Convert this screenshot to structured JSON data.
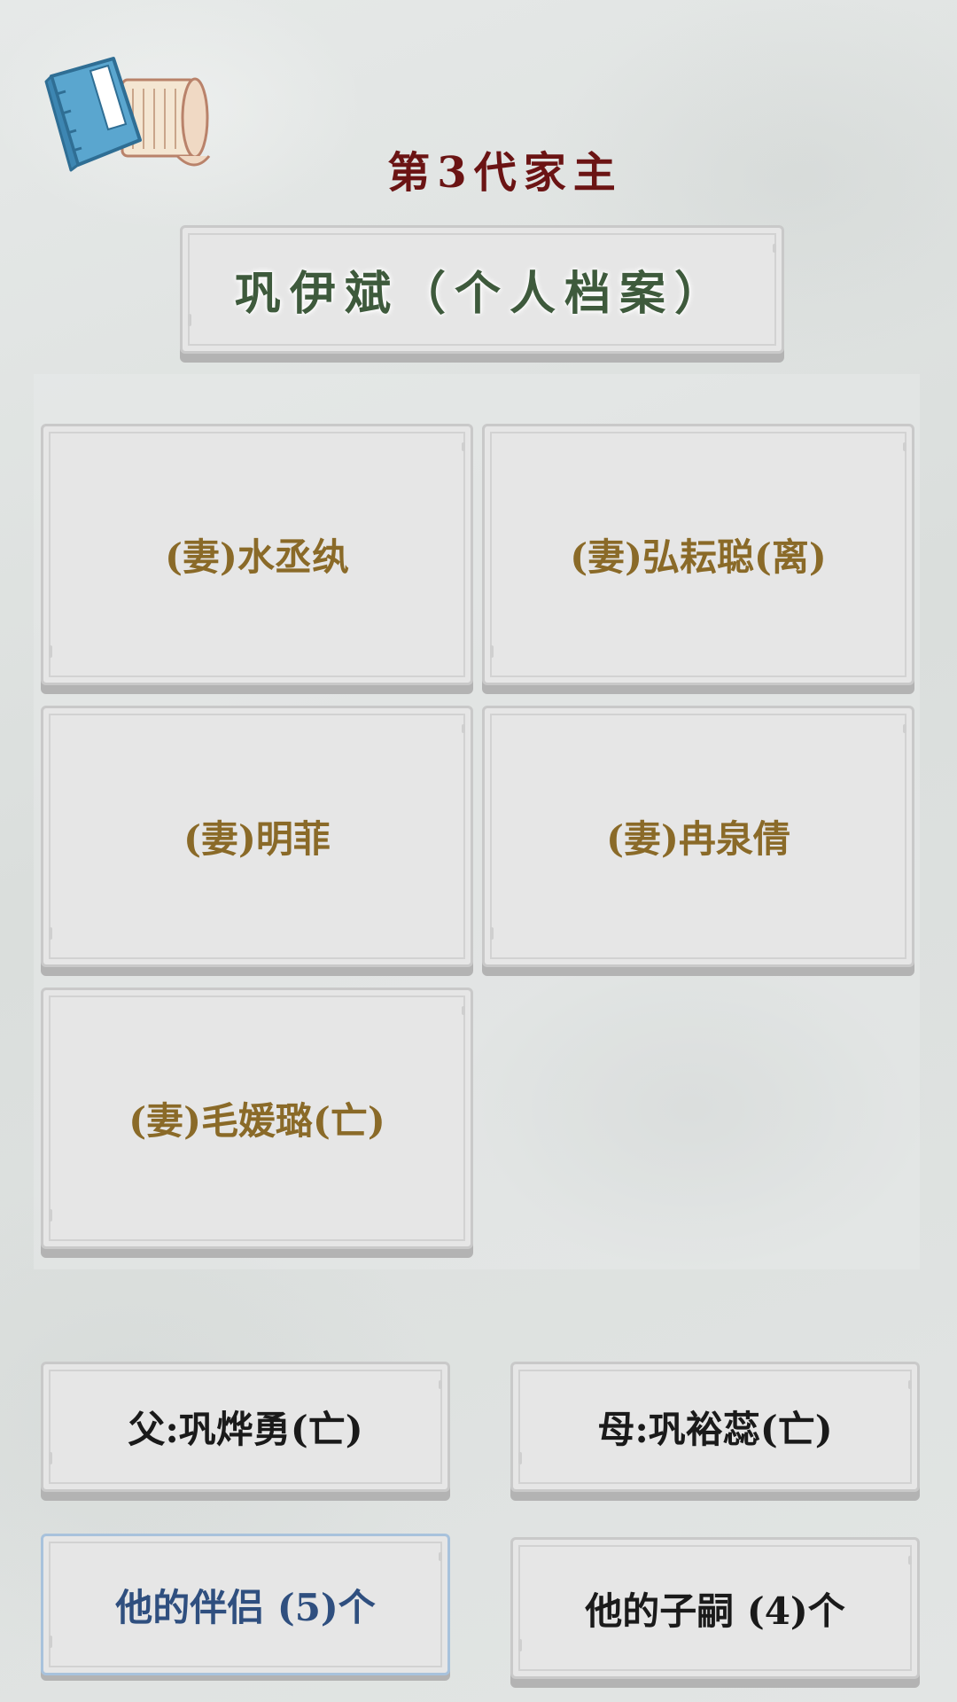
{
  "header": {
    "generation_title": "第3代家主",
    "profile_title": "巩伊斌（个人档案）"
  },
  "spouses": [
    {
      "label": "(妻)水丞纨"
    },
    {
      "label": "(妻)弘耘聪(离)"
    },
    {
      "label": "(妻)明菲"
    },
    {
      "label": "(妻)冉泉倩"
    },
    {
      "label": "(妻)毛媛璐(亡)"
    }
  ],
  "parents": {
    "father": "父:巩烨勇(亡)",
    "mother": "母:巩裕蕊(亡)"
  },
  "actions": {
    "partners_label": "他的伴侣 (5)个",
    "children_label": "他的子嗣 (4)个"
  },
  "icons": {
    "book": "book-scroll-icon"
  },
  "colors": {
    "title_red": "#6b1414",
    "profile_green": "#3e5a3c",
    "spouse_gold": "#8a6a28",
    "active_blue": "#2f4f7f"
  }
}
